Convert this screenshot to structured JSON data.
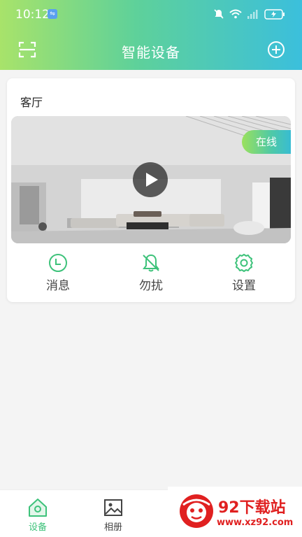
{
  "status_bar": {
    "time": "10:12"
  },
  "header": {
    "title": "智能设备"
  },
  "device_card": {
    "room_name": "客厅",
    "status_badge": "在线",
    "actions": [
      {
        "label": "消息",
        "icon": "clock-icon"
      },
      {
        "label": "勿扰",
        "icon": "bell-off-icon"
      },
      {
        "label": "设置",
        "icon": "gear-icon"
      }
    ]
  },
  "tabbar": {
    "tabs": [
      {
        "label": "设备",
        "icon": "home-icon",
        "active": true
      },
      {
        "label": "相册",
        "icon": "image-icon",
        "active": false
      }
    ]
  },
  "watermark": {
    "title": "92下载站",
    "url": "www.xz92.com"
  },
  "colors": {
    "accent": "#3dc27a",
    "header_start": "#a8e36a",
    "header_end": "#3bbfdc",
    "watermark": "#e02020"
  }
}
